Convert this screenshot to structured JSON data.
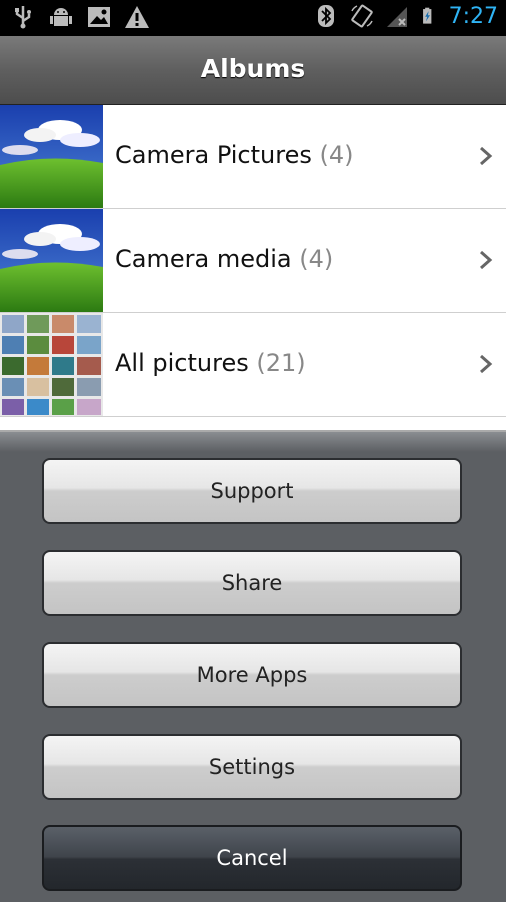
{
  "status_bar": {
    "time": "7:27",
    "icons": [
      "usb-icon",
      "android-debug-icon",
      "image-notification-icon",
      "warning-icon",
      "bluetooth-icon",
      "screen-rotate-icon",
      "signal-icon",
      "battery-charging-icon"
    ],
    "time_color": "#2fb4f5"
  },
  "header": {
    "title": "Albums"
  },
  "albums": [
    {
      "name": "Camera Pictures",
      "count": "(4)",
      "thumb": "sky-field"
    },
    {
      "name": "Camera media",
      "count": "(4)",
      "thumb": "sky-field"
    },
    {
      "name": "All pictures",
      "count": "(21)",
      "thumb": "mosaic"
    }
  ],
  "menu": {
    "buttons": [
      {
        "label": "Support"
      },
      {
        "label": "Share"
      },
      {
        "label": "More Apps"
      },
      {
        "label": "Settings"
      },
      {
        "label": "Cancel"
      }
    ]
  }
}
